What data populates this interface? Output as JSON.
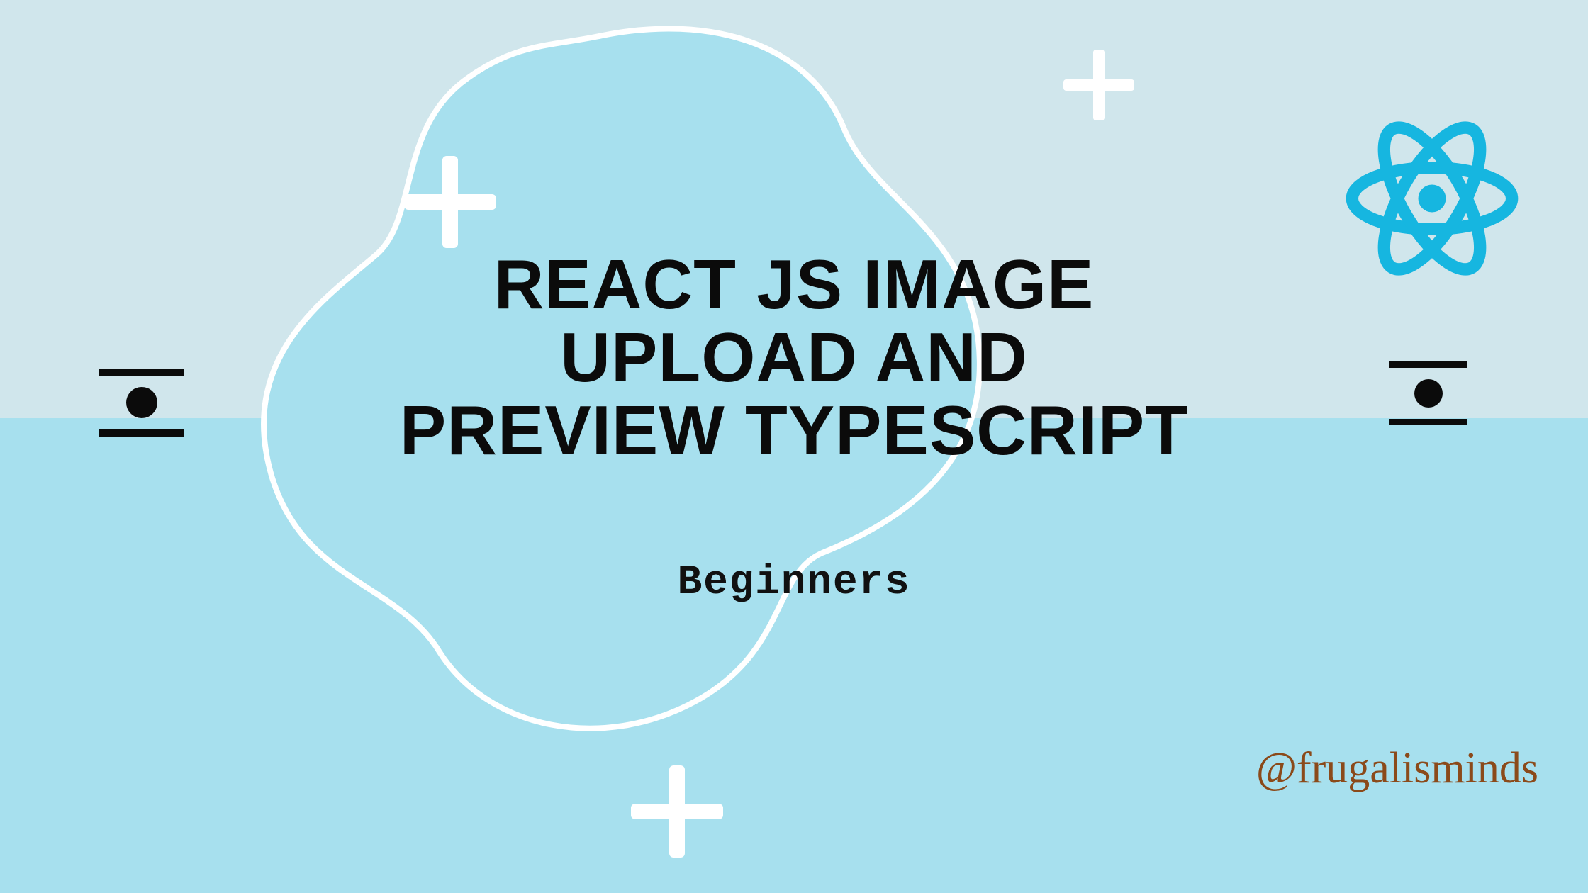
{
  "title_line1": "REACT JS IMAGE",
  "title_line2": "UPLOAD AND",
  "title_line3": "PREVIEW TYPESCRIPT",
  "subtitle": "Beginners",
  "handle": "@frugalisminds",
  "colors": {
    "bg_top": "#d0e6ec",
    "bg_bottom": "#a7e0ee",
    "blob_fill": "#a7e0ee",
    "blob_stroke": "#ffffff",
    "accent": "#ffffff",
    "text": "#0b0b0b",
    "handle": "#8b4a1a",
    "react": "#16b6e0"
  }
}
